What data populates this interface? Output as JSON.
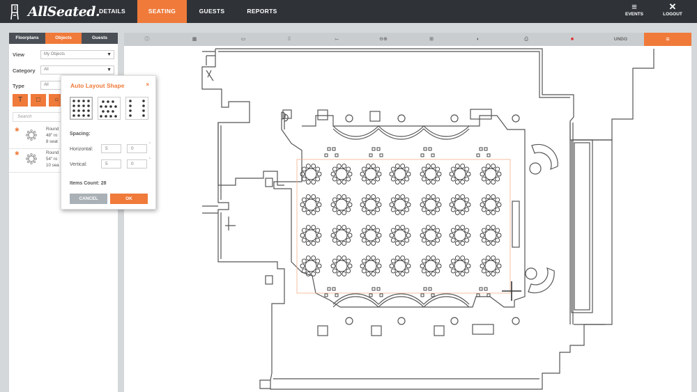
{
  "app": {
    "brand": "AllSeated."
  },
  "nav": {
    "items": [
      {
        "label": "DETAILS"
      },
      {
        "label": "SEATING"
      },
      {
        "label": "GUESTS"
      },
      {
        "label": "REPORTS"
      }
    ],
    "active": "SEATING",
    "events_label": "EVENTS",
    "logout_label": "LOGOUT"
  },
  "panel": {
    "tabs": [
      {
        "label": "Floorplans"
      },
      {
        "label": "Objects"
      },
      {
        "label": "Guests"
      }
    ],
    "view_label": "View",
    "view_value": "My Objects",
    "category_label": "Category",
    "category_value": "All",
    "type_label": "Type",
    "type_value": "All",
    "search_placeholder": "Search",
    "objects": [
      {
        "line1": "Round",
        "line2": "48\" ro",
        "line3": "8 seat"
      },
      {
        "line1": "Round",
        "line2": "54\" ro",
        "line3": "10 sea"
      }
    ]
  },
  "toolbar": {
    "undo_label": "UNDO"
  },
  "modal": {
    "title": "Auto Layout Shape",
    "close": "×",
    "spacing_label": "Spacing:",
    "horizontal_label": "Horizontal:",
    "horizontal_value": "5",
    "horizontal_value2": "0",
    "vertical_label": "Vertical:",
    "vertical_value": "5",
    "vertical_value2": "0",
    "dash": "\"",
    "items_count_label": "Items Count: 28",
    "cancel_label": "CANCEL",
    "ok_label": "OK"
  },
  "colors": {
    "accent": "#f07a3a",
    "topbar": "#2f3338",
    "panel_dark": "#4a4f55",
    "canvas_bar": "#c9cdd0"
  },
  "icons": {
    "shape_text": "T",
    "shape_square": "□",
    "shape_circle": "○",
    "events": "≡",
    "logout": "✕",
    "menu": "≡"
  }
}
